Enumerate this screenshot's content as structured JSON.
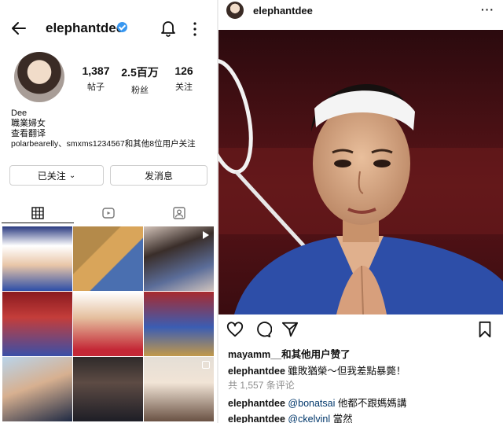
{
  "profile": {
    "username": "elephantdee",
    "stats": [
      {
        "value": "1,387",
        "label": "帖子"
      },
      {
        "value": "2.5百万",
        "label": "粉丝"
      },
      {
        "value": "126",
        "label": "关注"
      }
    ],
    "bio": {
      "name": "Dee",
      "title": "職業婦女",
      "translate": "查看翻译",
      "followed_by": "polarbearelly、smxms1234567和其他8位用户关注"
    },
    "buttons": {
      "following": "已关注",
      "message": "发消息"
    },
    "tab_icons": [
      "grid-icon",
      "reels-icon",
      "tagged-icon"
    ]
  },
  "post": {
    "username": "elephantdee",
    "more": "···",
    "likes": {
      "user": "mayamm__",
      "rest": "和其他用户赞了"
    },
    "caption": {
      "user": "elephantdee",
      "text": "雖敗猶榮～但我差點暴斃！"
    },
    "comments_link": "共 1,557 条评论",
    "comments": [
      {
        "user": "elephantdee",
        "mention": "@bonatsai",
        "text": " 他都不跟媽媽講"
      },
      {
        "user": "elephantdee",
        "mention": "@ckelvinl",
        "text": " 當然"
      }
    ]
  },
  "colors": {
    "verified": "#3897f0",
    "mention": "#00376b",
    "muted": "#8e8e8e",
    "jersey": "#2d4ea8"
  }
}
